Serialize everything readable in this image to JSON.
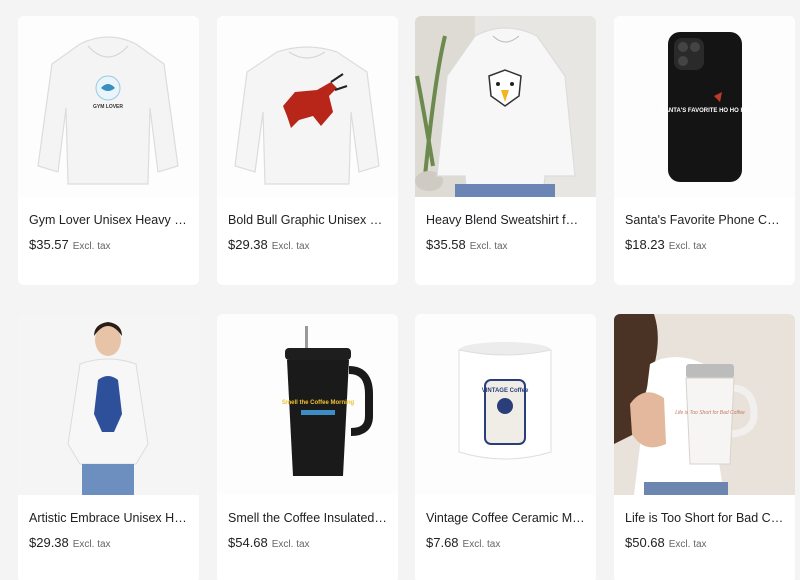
{
  "products": [
    {
      "title": "Gym Lover Unisex Heavy Blend Hoodie",
      "price": "$35.57",
      "tax": "Excl. tax",
      "image_icon": "hoodie-gym-lover-icon",
      "print_text": "GYM LOVER"
    },
    {
      "title": "Bold Bull Graphic Unisex Crewneck Sweatshirt",
      "price": "$29.38",
      "tax": "Excl. tax",
      "image_icon": "sweatshirt-bull-icon"
    },
    {
      "title": "Heavy Blend Sweatshirt for Outdoor Lovers",
      "price": "$35.58",
      "tax": "Excl. tax",
      "image_icon": "hoodie-eagle-model-icon"
    },
    {
      "title": "Santa's Favorite Phone Case Tough",
      "price": "$18.23",
      "tax": "Excl. tax",
      "image_icon": "phone-case-icon",
      "print_text": "SANTA'S FAVORITE HO HO HO"
    },
    {
      "title": "Artistic Embrace Unisex Heavy Blend Sweatshirt",
      "price": "$29.38",
      "tax": "Excl. tax",
      "image_icon": "sweatshirt-model-icon"
    },
    {
      "title": "Smell the Coffee Insulated Travel Mug",
      "price": "$54.68",
      "tax": "Excl. tax",
      "image_icon": "travel-tumbler-icon",
      "print_text": "Smell the Coffee Morning"
    },
    {
      "title": "Vintage Coffee Ceramic Mug",
      "price": "$7.68",
      "tax": "Excl. tax",
      "image_icon": "ceramic-mug-icon",
      "print_text": "VINTAGE Coffee"
    },
    {
      "title": "Life is Too Short for Bad Coffee Tumbler",
      "price": "$50.68",
      "tax": "Excl. tax",
      "image_icon": "tumbler-model-icon",
      "print_text": "Life is Too Short for Bad Coffee"
    }
  ],
  "colors": {
    "page_bg": "#f4f4f5",
    "card_bg": "#ffffff",
    "price": "#202124",
    "muted": "#666666"
  }
}
